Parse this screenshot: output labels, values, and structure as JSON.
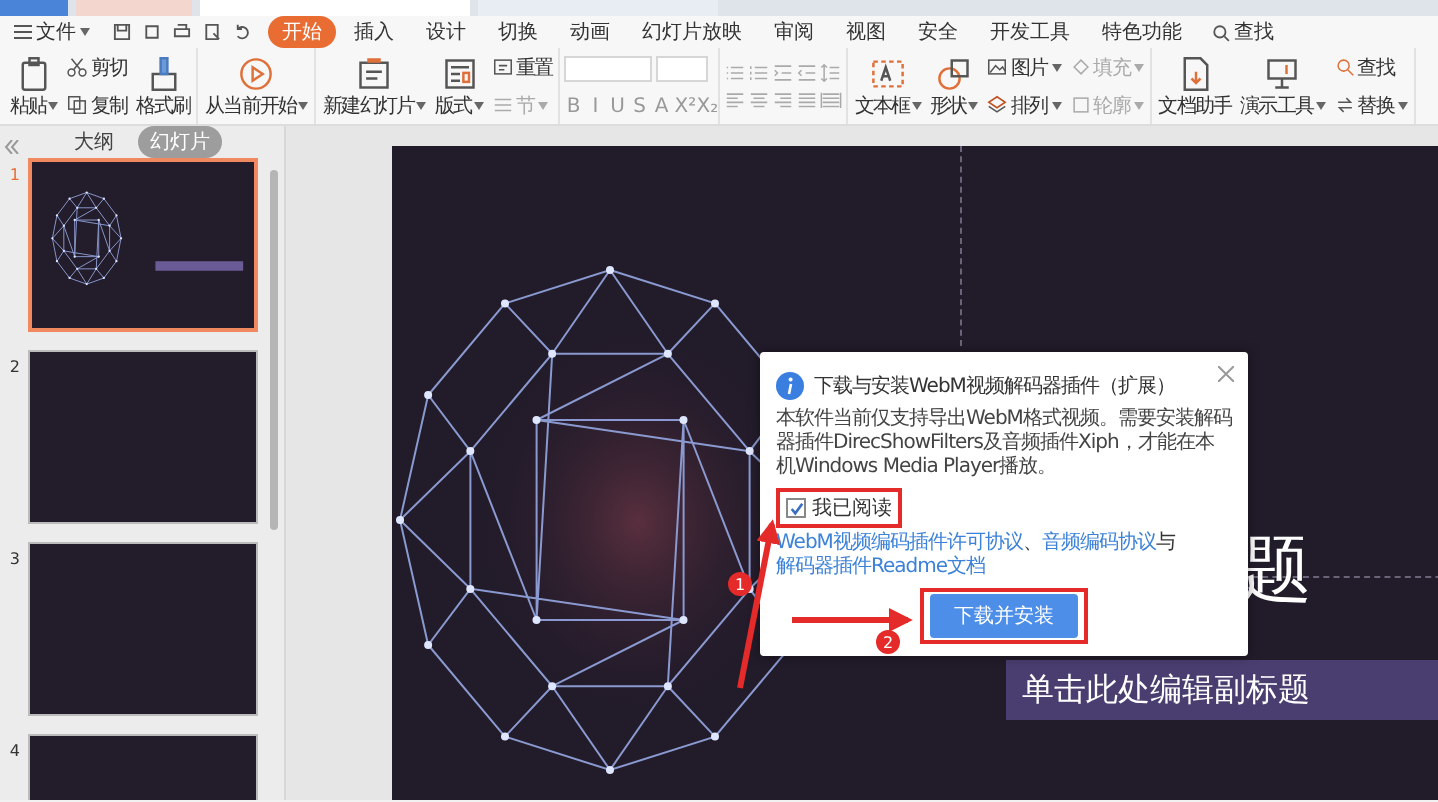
{
  "menu_bar": {
    "file_menu": "文件",
    "tabs": [
      {
        "label": "开始",
        "selected": true
      },
      {
        "label": "插入",
        "selected": false
      },
      {
        "label": "设计",
        "selected": false
      },
      {
        "label": "切换",
        "selected": false
      },
      {
        "label": "动画",
        "selected": false
      },
      {
        "label": "幻灯片放映",
        "selected": false
      },
      {
        "label": "审阅",
        "selected": false
      },
      {
        "label": "视图",
        "selected": false
      },
      {
        "label": "安全",
        "selected": false
      },
      {
        "label": "开发工具",
        "selected": false
      },
      {
        "label": "特色功能",
        "selected": false
      }
    ],
    "search": "查找"
  },
  "ribbon": {
    "groups": [
      {
        "kind": "buttons",
        "columns": [
          [
            {
              "kind": "large",
              "label": "粘贴",
              "caret": true,
              "disabled": false
            }
          ],
          [
            {
              "kind": "small",
              "label": "剪切",
              "caret": false,
              "disabled": false
            },
            {
              "kind": "small",
              "label": "复制",
              "caret": false,
              "disabled": false
            }
          ],
          [
            {
              "kind": "large",
              "label": "格式刷",
              "caret": false,
              "disabled": false
            }
          ]
        ]
      },
      {
        "kind": "buttons",
        "columns": [
          [
            {
              "kind": "large",
              "label": "从当前开始",
              "caret": true,
              "disabled": false
            }
          ]
        ]
      },
      {
        "kind": "buttons",
        "columns": [
          [
            {
              "kind": "large",
              "label": "新建幻灯片",
              "caret": true,
              "disabled": false
            }
          ],
          [
            {
              "kind": "large",
              "label": "版式",
              "caret": true,
              "disabled": false
            }
          ],
          [
            {
              "kind": "small",
              "label": "重置",
              "caret": false,
              "disabled": false
            },
            {
              "kind": "small",
              "label": "节",
              "caret": true,
              "disabled": true
            }
          ]
        ]
      },
      {
        "kind": "font",
        "glyphs": [
          "B",
          "I",
          "U",
          "S",
          "A",
          "X²",
          "X₂"
        ]
      },
      {
        "kind": "paragraph"
      },
      {
        "kind": "buttons",
        "columns": [
          [
            {
              "kind": "large",
              "label": "文本框",
              "caret": true,
              "disabled": false
            }
          ],
          [
            {
              "kind": "large",
              "label": "形状",
              "caret": true,
              "disabled": false
            }
          ],
          [
            {
              "kind": "small",
              "label": "图片",
              "caret": true,
              "disabled": false
            },
            {
              "kind": "small",
              "label": "排列",
              "caret": true,
              "disabled": false
            }
          ],
          [
            {
              "kind": "small",
              "label": "填充",
              "caret": true,
              "disabled": true
            },
            {
              "kind": "small",
              "label": "轮廓",
              "caret": true,
              "disabled": true
            }
          ]
        ]
      },
      {
        "kind": "buttons",
        "columns": [
          [
            {
              "kind": "large",
              "label": "文档助手",
              "caret": false,
              "disabled": false
            }
          ],
          [
            {
              "kind": "large",
              "label": "演示工具",
              "caret": true,
              "disabled": false
            }
          ],
          [
            {
              "kind": "small",
              "label": "查找",
              "caret": false,
              "disabled": false
            },
            {
              "kind": "small",
              "label": "替换",
              "caret": true,
              "disabled": false
            }
          ]
        ]
      }
    ]
  },
  "slide_panel": {
    "views": [
      {
        "label": "大纲",
        "selected": false
      },
      {
        "label": "幻灯片",
        "selected": true
      }
    ],
    "slides": [
      {
        "number": "1",
        "selected": true,
        "kind": "title"
      },
      {
        "number": "2",
        "selected": false,
        "kind": "blank"
      },
      {
        "number": "3",
        "selected": false,
        "kind": "blank"
      },
      {
        "number": "4",
        "selected": false,
        "kind": "blank"
      }
    ]
  },
  "slide": {
    "title": "题",
    "subtitle": "单击此处编辑副标题"
  },
  "dialog": {
    "title": "下载与安装WebM视频解码器插件（扩展）",
    "body": "本软件当前仅支持导出WebM格式视频。需要安装解码器插件DirecShowFilters及音频插件Xiph，才能在本机Windows Media Player播放。",
    "checkbox": {
      "label": "我已阅读",
      "checked": true
    },
    "agreement": {
      "links": [
        "WebM视频编码插件许可协议",
        "音频编码协议",
        "解码器插件Readme文档"
      ],
      "separators": [
        "、",
        "与"
      ]
    },
    "button": "下载并安装"
  },
  "annotations": {
    "steps": [
      "1",
      "2"
    ]
  }
}
